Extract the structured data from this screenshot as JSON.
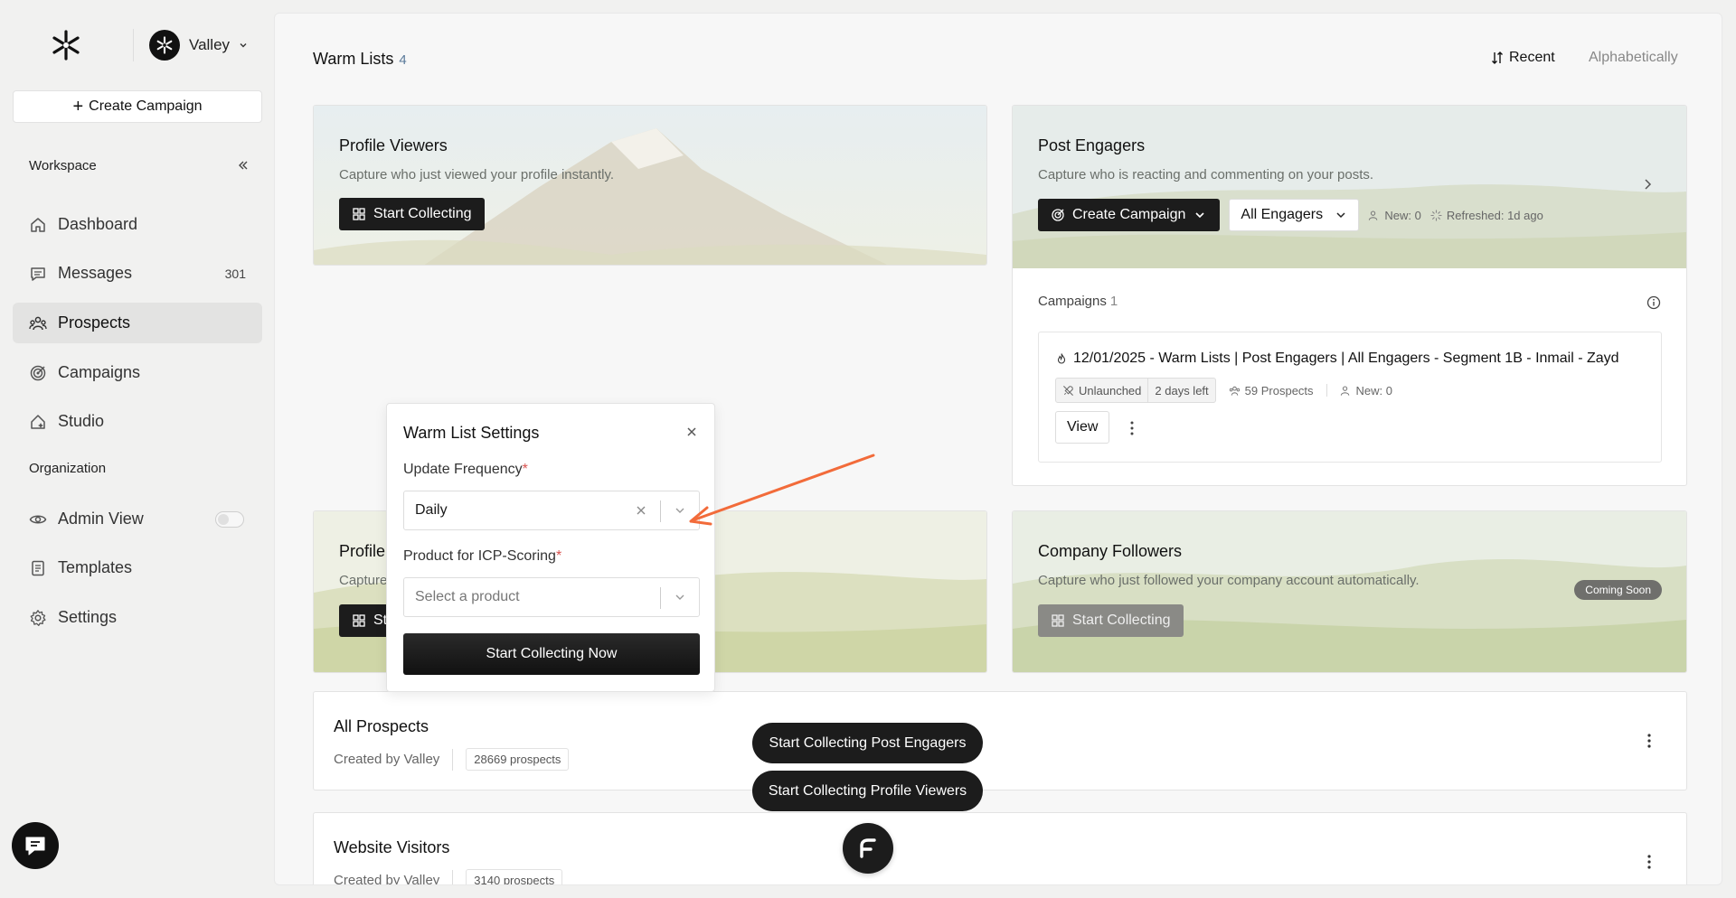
{
  "workspace": {
    "name": "Valley"
  },
  "sidebar": {
    "create_campaign": "Create Campaign",
    "workspace_label": "Workspace",
    "organization_label": "Organization",
    "items": [
      {
        "label": "Dashboard",
        "icon": "home-icon"
      },
      {
        "label": "Messages",
        "icon": "message-icon",
        "count": "301"
      },
      {
        "label": "Prospects",
        "icon": "users-icon",
        "active": true
      },
      {
        "label": "Campaigns",
        "icon": "target-icon"
      },
      {
        "label": "Studio",
        "icon": "studio-icon"
      }
    ],
    "org_items": [
      {
        "label": "Admin View",
        "icon": "eye-icon",
        "toggle": false
      },
      {
        "label": "Templates",
        "icon": "document-icon"
      },
      {
        "label": "Settings",
        "icon": "gear-icon"
      }
    ]
  },
  "main": {
    "title": "Warm Lists",
    "count": "4",
    "sort_recent": "Recent",
    "sort_alpha": "Alphabetically"
  },
  "cards": {
    "profile_viewers": {
      "title": "Profile Viewers",
      "desc": "Capture who just viewed your profile instantly.",
      "button": "Start Collecting"
    },
    "post_engagers": {
      "title": "Post Engagers",
      "desc": "Capture who is reacting and commenting on your posts.",
      "button": "Create Campaign",
      "select": "All Engagers",
      "new": "New: 0",
      "refreshed": "Refreshed: 1d ago",
      "campaigns_label": "Campaigns",
      "campaigns_count": "1",
      "campaign": {
        "title": "12/01/2025 - Warm Lists | Post Engagers | All Engagers - Segment 1B - Inmail - Zayd",
        "status": "Unlaunched",
        "days_left": "2 days left",
        "prospects": "59 Prospects",
        "new": "New: 0",
        "view": "View"
      }
    },
    "profile_second": {
      "title": "Profile",
      "desc": "Capture",
      "button": "St"
    },
    "company_followers": {
      "title": "Company Followers",
      "desc": "Capture who just followed your company account automatically.",
      "button": "Start Collecting",
      "badge": "Coming Soon"
    }
  },
  "lists": [
    {
      "title": "All Prospects",
      "created_by": "Created by Valley",
      "count": "28669 prospects"
    },
    {
      "title": "Website Visitors",
      "created_by": "Created by Valley",
      "count": "3140 prospects"
    }
  ],
  "modal": {
    "title": "Warm List Settings",
    "frequency_label": "Update Frequency",
    "frequency_value": "Daily",
    "product_label": "Product for ICP-Scoring",
    "product_placeholder": "Select a product",
    "required_mark": "*",
    "submit": "Start Collecting Now"
  },
  "floating": {
    "post_engagers": "Start Collecting Post Engagers",
    "profile_viewers": "Start Collecting Profile Viewers"
  },
  "colors": {
    "accent_arrow": "#f26b3a",
    "dark": "#1c1c1c"
  }
}
